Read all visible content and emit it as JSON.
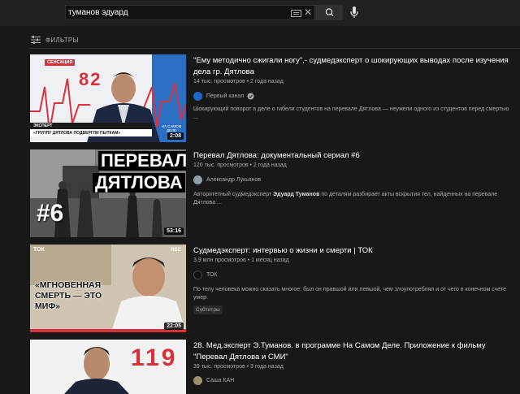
{
  "search": {
    "query": "туманов эдуард"
  },
  "filters": {
    "label": "ФИЛЬТРЫ"
  },
  "videos": [
    {
      "title": "\"Ему методично сжигали ногу\",- судмедэксперт о шокирующих выводах после изучения дела гр. Дятлова",
      "meta": "14 тыс. просмотров • 2 года назад",
      "channel": "Первый канал",
      "description": "Шокирующий поворот в деле о гибели студентов на перевале Дятлова — неужели одного из студентов перед смертью ...",
      "duration": "2:08",
      "thumb_tag": "СЕНСАЦИЯ",
      "thumb_number": "82",
      "thumb_caption_1": "ЭКСПЕРТ",
      "thumb_caption_2": "«ГРУППУ ДЯТЛОВА ПОДВЕРГЛИ ПЫТКАМ»",
      "thumb_logo": "НА САМОМ ДЕЛЕ"
    },
    {
      "title": "Перевал Дятлова: документальный сериал #6",
      "meta": "120 тыс. просмотров • 2 года назад",
      "channel": "Александр Лукьянов",
      "description_parts": [
        "Авторитетный судмедэксперт ",
        "Эдуард Туманов",
        " по деталям разбирает акты вскрытия тел, найденных на перевале Дятлова ..."
      ],
      "duration": "53:16",
      "thumb_line1": "ПЕРЕВАЛ",
      "thumb_line2": "ДЯТЛОВА",
      "thumb_num": "#6"
    },
    {
      "title": "Судмедэксперт: интервью о жизни и смерти | ТОК",
      "meta": "3,9 млн просмотров • 1 месяц назад",
      "channel": "ТОК",
      "description": "По телу человека можно сказать многое: был он правшой или левшой, чем злоупотреблял и от чего в конечном счете умер.",
      "badge": "Субтитры",
      "duration": "22:05",
      "thumb_logo": "ТОК",
      "thumb_rec": "REC",
      "thumb_text": "«МГНОВЕННАЯ СМЕРТЬ — ЭТО МИФ»"
    },
    {
      "title": "28. Мед.эксперт Э.Туманов. в программе На Самом Деле. Приложение к фильму \"Перевал Дятлова и СМИ\"",
      "meta": "39 тыс. просмотров • 3 года назад",
      "channel": "Саша КАН",
      "thumb_number": "119"
    }
  ],
  "colors": {
    "background": "#181818",
    "topbar": "#212121",
    "text_secondary": "#aaaaaa",
    "accent_red": "#cc0000"
  }
}
